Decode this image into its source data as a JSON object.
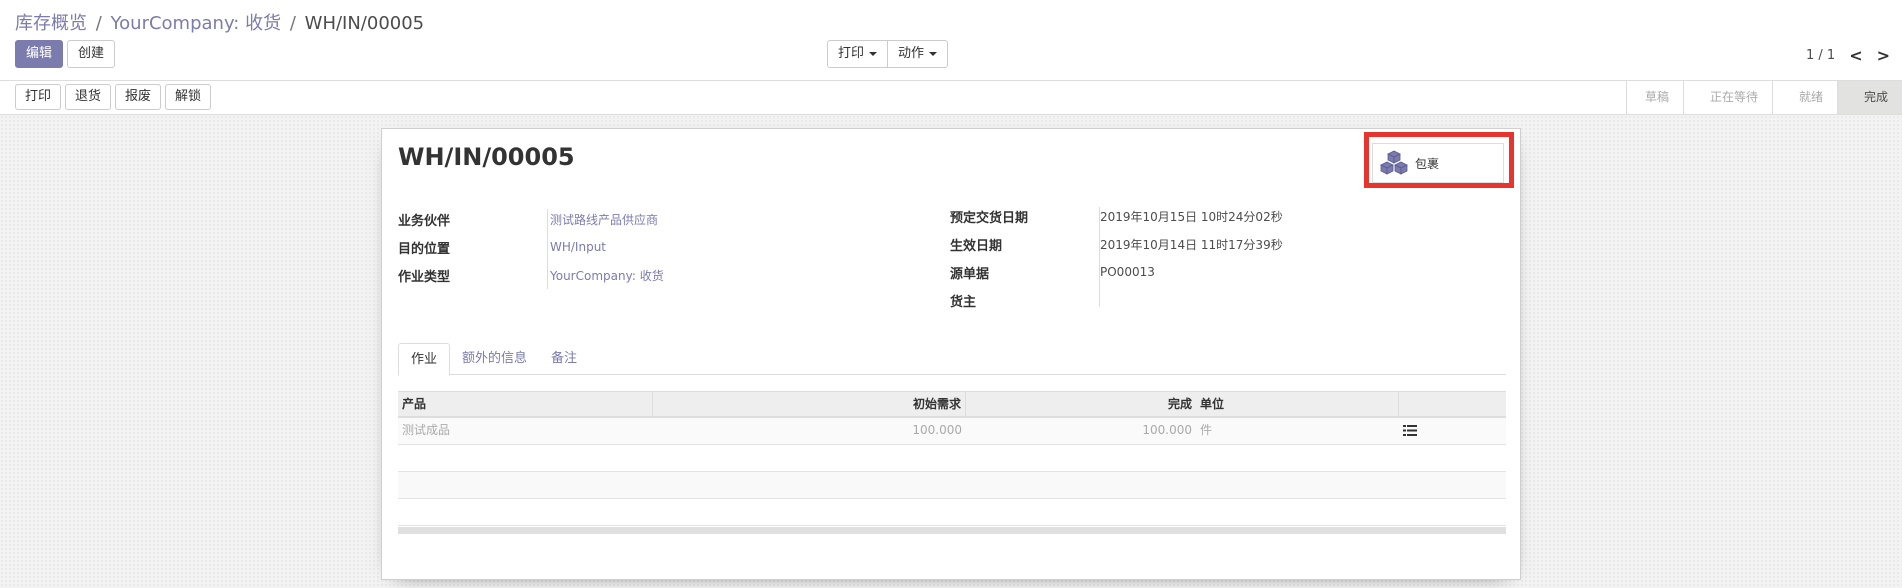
{
  "breadcrumb": {
    "items": [
      "库存概览",
      "YourCompany: 收货"
    ],
    "separator": "/",
    "current": "WH/IN/00005"
  },
  "toolbar": {
    "edit_label": "编辑",
    "create_label": "创建",
    "print_label": "打印",
    "action_label": "动作"
  },
  "pager": {
    "value": "1 / 1",
    "prev": "<",
    "next": ">"
  },
  "statusbar": {
    "buttons": [
      "打印",
      "退货",
      "报废",
      "解锁"
    ],
    "stages": [
      "草稿",
      "正在等待",
      "就绪",
      "完成"
    ],
    "active_stage": "完成"
  },
  "record": {
    "title": "WH/IN/00005",
    "smart_button_label": "包裹",
    "left_fields": [
      {
        "label": "业务伙伴",
        "value": "测试路线产品供应商"
      },
      {
        "label": "目的位置",
        "value": "WH/Input"
      },
      {
        "label": "作业类型",
        "value": "YourCompany: 收货"
      }
    ],
    "right_fields": [
      {
        "label": "预定交货日期",
        "value": "2019年10月15日 10时24分02秒"
      },
      {
        "label": "生效日期",
        "value": "2019年10月14日 11时17分39秒"
      },
      {
        "label": "源单据",
        "value": "PO00013"
      },
      {
        "label": "货主",
        "value": ""
      }
    ]
  },
  "tabs": [
    "作业",
    "额外的信息",
    "备注"
  ],
  "table": {
    "headers": [
      "产品",
      "初始需求",
      "完成",
      "单位"
    ],
    "rows": [
      {
        "product": "测试成品",
        "demand": "100.000",
        "done": "100.000",
        "uom": "件"
      }
    ]
  },
  "colors": {
    "accent": "#7c7bad",
    "highlight": "#e8342e"
  }
}
